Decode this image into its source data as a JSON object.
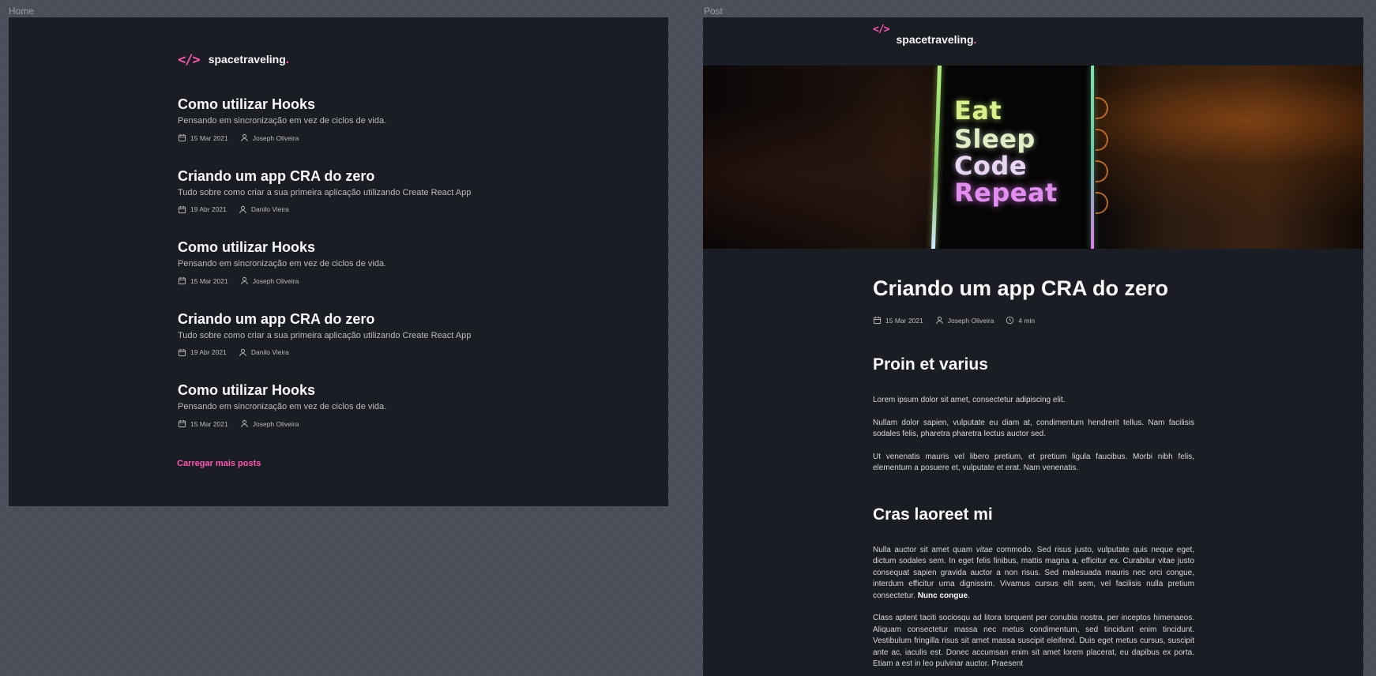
{
  "frames": {
    "home_label": "Home",
    "post_label": "Post"
  },
  "brand": {
    "icon": "</>",
    "name": "spacetraveling",
    "dot": "."
  },
  "home": {
    "posts": [
      {
        "title": "Como utilizar Hooks",
        "subtitle": "Pensando em sincronização em vez de ciclos de vida.",
        "date": "15 Mar 2021",
        "author": "Joseph Oliveira"
      },
      {
        "title": "Criando um app CRA do zero",
        "subtitle": "Tudo sobre como criar a sua primeira aplicação utilizando Create React App",
        "date": "19 Abr 2021",
        "author": "Danilo Vieira"
      },
      {
        "title": "Como utilizar Hooks",
        "subtitle": "Pensando em sincronização em vez de ciclos de vida.",
        "date": "15 Mar 2021",
        "author": "Joseph Oliveira"
      },
      {
        "title": "Criando um app CRA do zero",
        "subtitle": "Tudo sobre como criar a sua primeira aplicação utilizando Create React App",
        "date": "19 Abr 2021",
        "author": "Danilo Vieira"
      },
      {
        "title": "Como utilizar Hooks",
        "subtitle": "Pensando em sincronização em vez de ciclos de vida.",
        "date": "15 Mar 2021",
        "author": "Joseph Oliveira"
      }
    ],
    "load_more": "Carregar mais posts"
  },
  "post": {
    "banner_text": [
      "Eat",
      "Sleep",
      "Code",
      "Repeat"
    ],
    "title": "Criando um app CRA do zero",
    "date": "15 Mar 2021",
    "author": "Joseph Oliveira",
    "reading_time": "4 min",
    "sections": [
      {
        "heading": "Proin et varius",
        "paragraphs": [
          "Lorem ipsum dolor sit amet, consectetur adipiscing elit.",
          "Nullam dolor sapien, vulputate eu diam at, condimentum hendrerit tellus. Nam facilisis sodales felis, pharetra pharetra lectus auctor sed.",
          "Ut venenatis mauris vel libero pretium, et pretium ligula faucibus. Morbi nibh felis, elementum a posuere et, vulputate et erat. Nam venenatis."
        ]
      },
      {
        "heading": "Cras laoreet mi",
        "p1_a": "Nulla auctor sit amet quam ",
        "p1_em": "vitae",
        "p1_b": " commodo. Sed risus justo, vulputate quis neque eget, dictum sodales sem. In eget felis finibus, mattis magna a, efficitur ex. Curabitur vitae justo consequat sapien gravida auctor a non risus. Sed malesuada mauris nec orci congue, interdum efficitur urna dignissim. Vivamus cursus elit sem, vel facilisis nulla pretium consectetur. ",
        "p1_strong": "Nunc congue",
        "p1_end": ".",
        "p2": "Class aptent taciti sociosqu ad litora torquent per conubia nostra, per inceptos himenaeos. Aliquam consectetur massa nec metus condimentum, sed tincidunt enim tincidunt. Vestibulum fringilla risus sit amet massa suscipit eleifend. Duis eget metus cursus, suscipit ante ac, iaculis est. Donec accumsan enim sit amet lorem placerat, eu dapibus ex porta. Etiam a est in leo pulvinar auctor. Praesent"
      }
    ]
  },
  "colors": {
    "background": "#4a4d57",
    "frame": "#1a1d23",
    "accent": "#ff57b2",
    "heading": "#f8f8f8",
    "body": "#bbbbbb"
  },
  "icons": {
    "date": "calendar-icon",
    "author": "user-icon",
    "time": "clock-icon"
  }
}
